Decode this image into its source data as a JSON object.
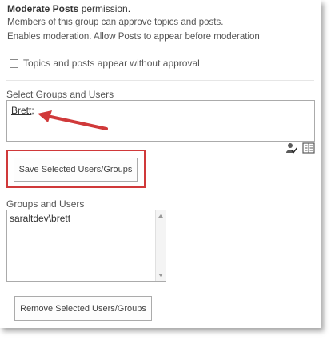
{
  "permission": {
    "name": "Moderate Posts",
    "suffix": " permission.",
    "description_line1": "Members of this group can approve topics and posts.",
    "description_line2": "Enables moderation. Allow Posts to appear before moderation"
  },
  "approval_checkbox": {
    "label": "Topics and posts appear without approval",
    "checked": false
  },
  "picker": {
    "label": "Select Groups and Users",
    "entry_name": "Brett",
    "entry_separator": ";",
    "icons": [
      "check-names-icon",
      "browse-address-book-icon"
    ]
  },
  "save_button": {
    "label": "Save Selected Users/Groups"
  },
  "groups_list": {
    "label": "Groups and Users",
    "items": [
      "saraltdev\\brett"
    ]
  },
  "remove_button": {
    "label": "Remove Selected Users/Groups"
  },
  "colors": {
    "annotation_red": "#d0393a",
    "border": "#ababab",
    "text": "#555555"
  }
}
